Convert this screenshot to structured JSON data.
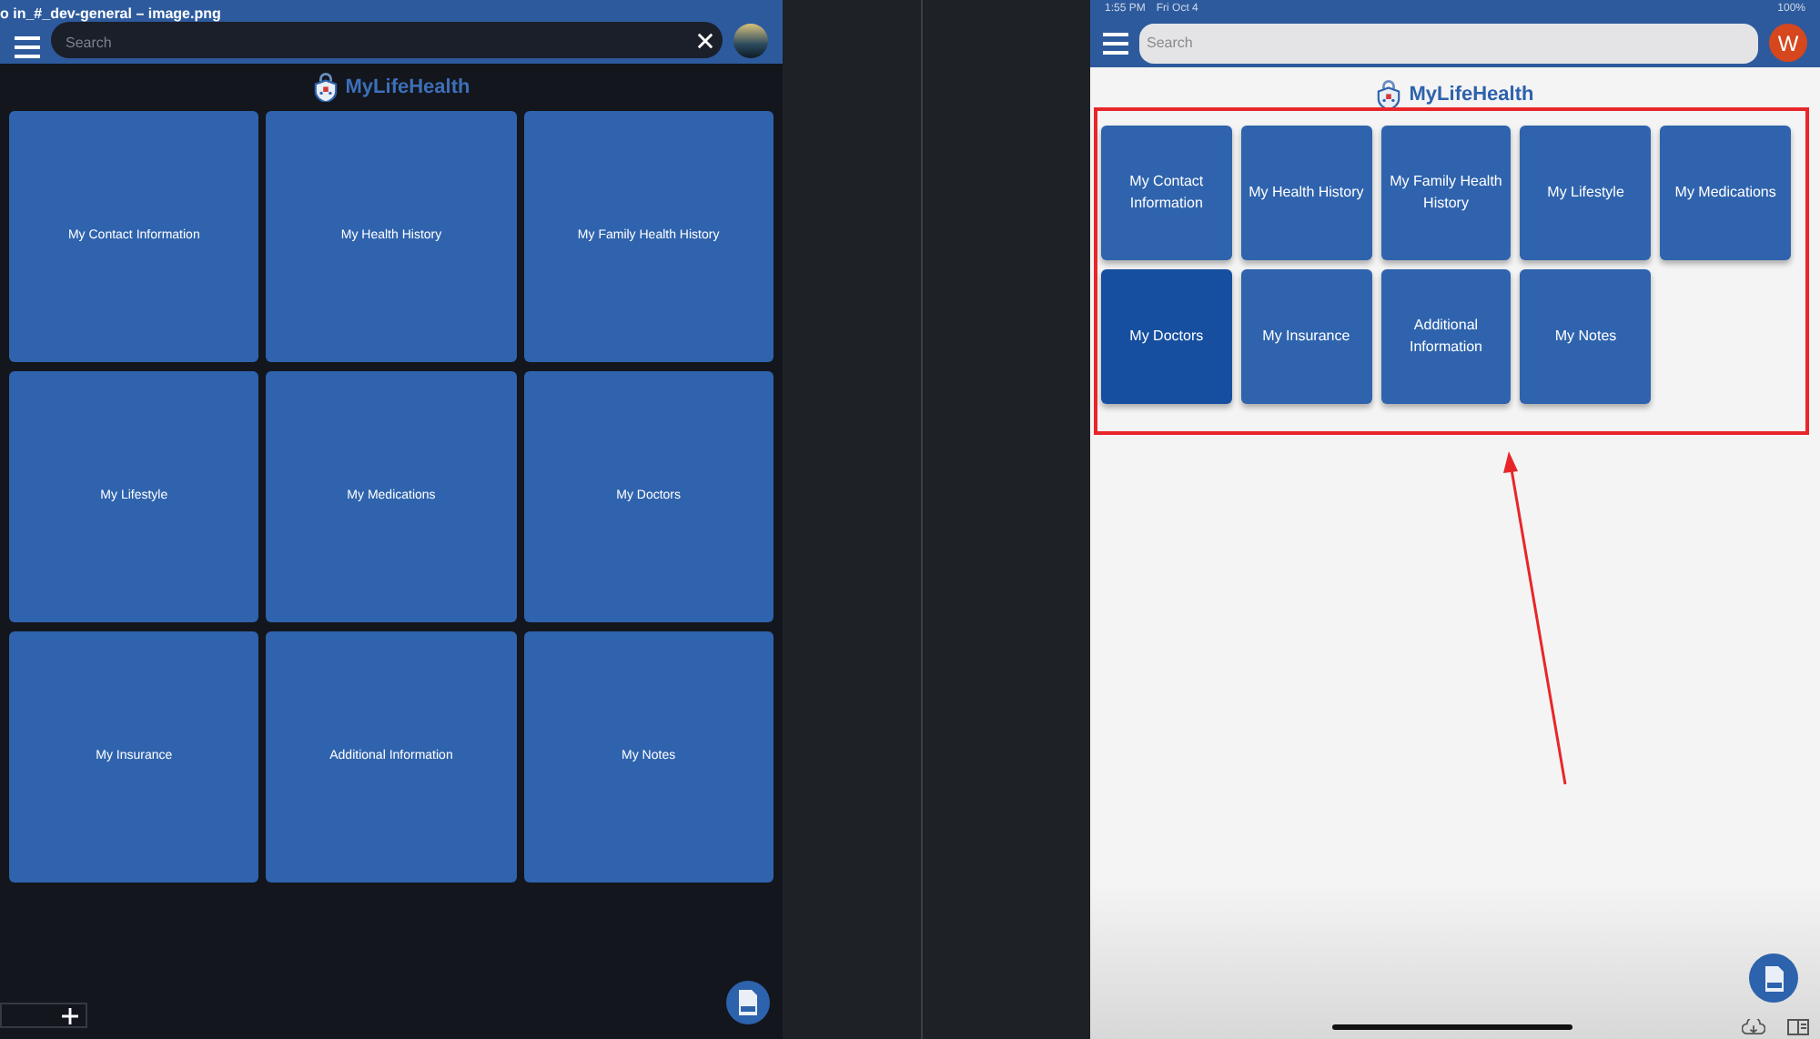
{
  "left_screen": {
    "window_title": "o in_#_dev-general  – image.png",
    "search": {
      "placeholder": "Search"
    },
    "logo": "MyLifeHealth",
    "tiles": [
      {
        "label": "My Contact Information",
        "selected": false
      },
      {
        "label": "My Health History",
        "selected": false
      },
      {
        "label": "My Family Health History",
        "selected": false
      },
      {
        "label": "My Lifestyle",
        "selected": false
      },
      {
        "label": "My Medications",
        "selected": false
      },
      {
        "label": "My Doctors",
        "selected": false
      },
      {
        "label": "My Insurance",
        "selected": false
      },
      {
        "label": "Additional Information",
        "selected": false
      },
      {
        "label": "My Notes",
        "selected": false
      }
    ]
  },
  "right_screen": {
    "status_bar": {
      "time": "1:55 PM",
      "date": "Fri Oct 4",
      "battery": "100%"
    },
    "search": {
      "placeholder": "Search"
    },
    "avatar": "W",
    "logo": "MyLifeHealth",
    "tiles": [
      {
        "label": "My Contact Information",
        "selected": false
      },
      {
        "label": "My Health History",
        "selected": false
      },
      {
        "label": "My Family Health History",
        "selected": false
      },
      {
        "label": "My Lifestyle",
        "selected": false
      },
      {
        "label": "My Medications",
        "selected": false
      },
      {
        "label": "My Doctors",
        "selected": true
      },
      {
        "label": "My Insurance",
        "selected": false
      },
      {
        "label": "Additional Information",
        "selected": false
      },
      {
        "label": "My Notes",
        "selected": false
      }
    ]
  }
}
